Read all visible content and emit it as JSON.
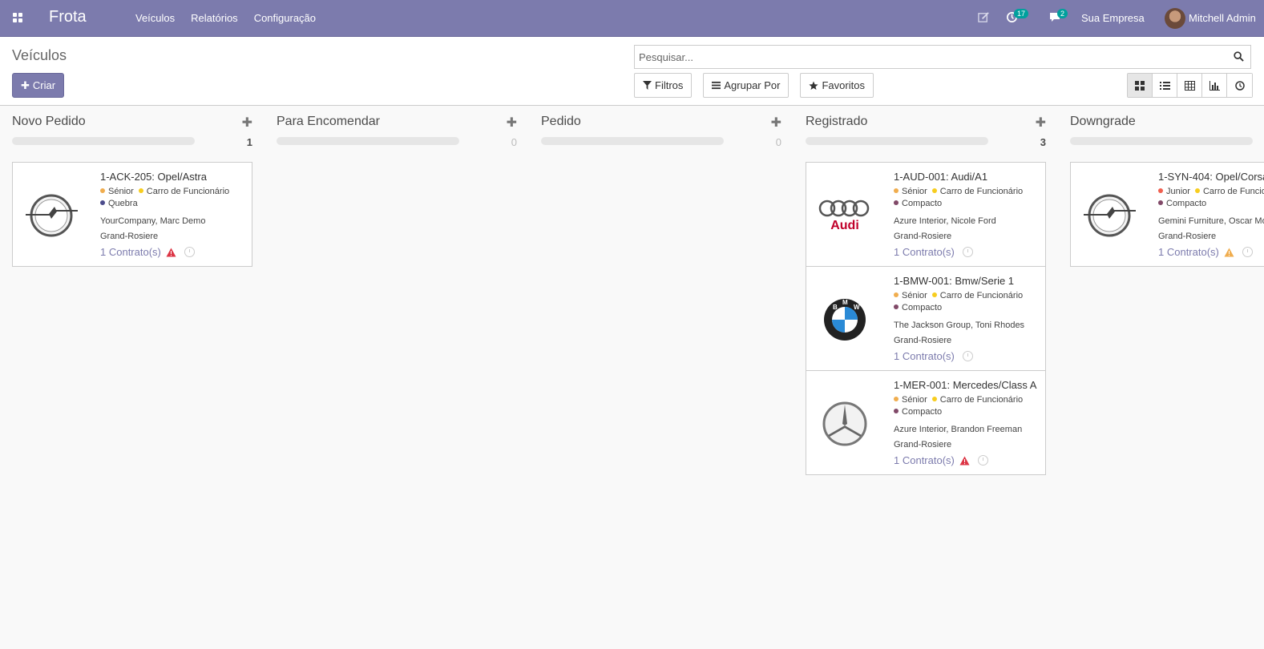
{
  "navbar": {
    "brand": "Frota",
    "menu": [
      "Veículos",
      "Relatórios",
      "Configuração"
    ],
    "activity_count": "17",
    "messages_count": "2",
    "company": "Sua Empresa",
    "user": "Mitchell Admin"
  },
  "control": {
    "breadcrumb": "Veículos",
    "create_label": "Criar",
    "search_placeholder": "Pesquisar...",
    "filters_label": "Filtros",
    "groupby_label": "Agrupar Por",
    "favorites_label": "Favoritos"
  },
  "colors": {
    "accent": "#7c7bad",
    "danger": "#dc3545",
    "warning": "#f0ad4e"
  },
  "columns": [
    {
      "title": "Novo Pedido",
      "count": "1",
      "show_add": true,
      "cards": [
        {
          "name": "1-ACK-205: Opel/Astra",
          "logo": "opel",
          "tags": [
            {
              "label": "Sénior",
              "color": "#f0ad4e"
            },
            {
              "label": "Carro de Funcionário",
              "color": "#f7cd1f"
            },
            {
              "label": "Quebra",
              "color": "#4c4c8c"
            }
          ],
          "partner": "YourCompany, Marc Demo",
          "location": "Grand-Rosiere",
          "contracts": "1 Contrato(s)",
          "alert": "danger"
        }
      ]
    },
    {
      "title": "Para Encomendar",
      "count": "0",
      "show_add": true,
      "cards": []
    },
    {
      "title": "Pedido",
      "count": "0",
      "show_add": true,
      "cards": []
    },
    {
      "title": "Registrado",
      "count": "3",
      "show_add": true,
      "cards": [
        {
          "name": "1-AUD-001: Audi/A1",
          "logo": "audi",
          "tags": [
            {
              "label": "Sénior",
              "color": "#f0ad4e"
            },
            {
              "label": "Carro de Funcionário",
              "color": "#f7cd1f"
            },
            {
              "label": "Compacto",
              "color": "#814968"
            }
          ],
          "partner": "Azure Interior, Nicole Ford",
          "location": "Grand-Rosiere",
          "contracts": "1 Contrato(s)",
          "alert": ""
        },
        {
          "name": "1-BMW-001: Bmw/Serie 1",
          "logo": "bmw",
          "tags": [
            {
              "label": "Sénior",
              "color": "#f0ad4e"
            },
            {
              "label": "Carro de Funcionário",
              "color": "#f7cd1f"
            },
            {
              "label": "Compacto",
              "color": "#814968"
            }
          ],
          "partner": "The Jackson Group, Toni Rhodes",
          "location": "Grand-Rosiere",
          "contracts": "1 Contrato(s)",
          "alert": ""
        },
        {
          "name": "1-MER-001: Mercedes/Class A",
          "logo": "mercedes",
          "tags": [
            {
              "label": "Sénior",
              "color": "#f0ad4e"
            },
            {
              "label": "Carro de Funcionário",
              "color": "#f7cd1f"
            },
            {
              "label": "Compacto",
              "color": "#814968"
            }
          ],
          "partner": "Azure Interior, Brandon Freeman",
          "location": "Grand-Rosiere",
          "contracts": "1 Contrato(s)",
          "alert": "danger"
        }
      ]
    },
    {
      "title": "Downgrade",
      "count": "",
      "show_add": false,
      "cards": [
        {
          "name": "1-SYN-404: Opel/Corsa",
          "logo": "opel",
          "tags": [
            {
              "label": "Junior",
              "color": "#f06050"
            },
            {
              "label": "Carro de Funcionário",
              "color": "#f7cd1f"
            },
            {
              "label": "Compacto",
              "color": "#814968"
            }
          ],
          "partner": "Gemini Furniture, Oscar Morgan",
          "location": "Grand-Rosiere",
          "contracts": "1 Contrato(s)",
          "alert": "warning"
        }
      ]
    }
  ]
}
